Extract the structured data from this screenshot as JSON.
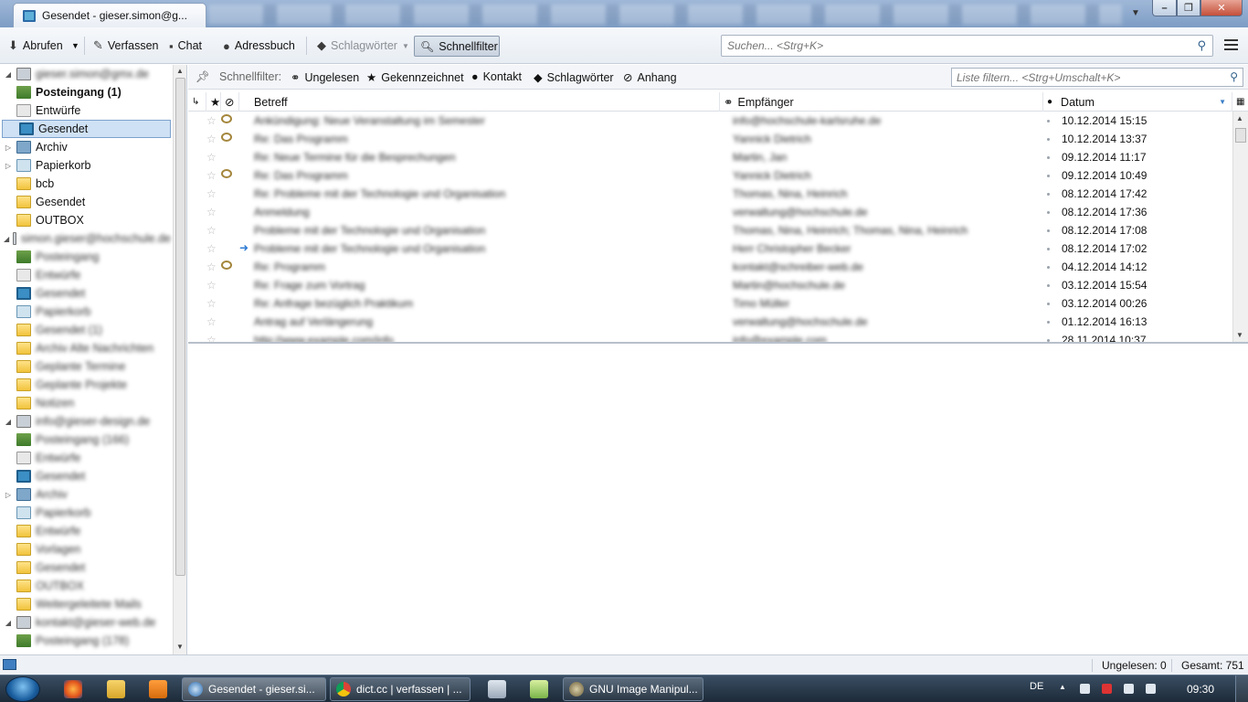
{
  "window": {
    "tab_title": "Gesendet - gieser.simon@g...",
    "close_glyph": "✕",
    "max_glyph": "❐",
    "min_glyph": "–"
  },
  "toolbar": {
    "abrufen": "Abrufen",
    "verfassen": "Verfassen",
    "chat": "Chat",
    "adressbuch": "Adressbuch",
    "schlagwoerter": "Schlagwörter",
    "schnellfilter": "Schnellfilter",
    "search_placeholder": "Suchen... <Strg+K>"
  },
  "folders": {
    "account1": "gieser.simon@gmx.de",
    "items": [
      {
        "label": "Posteingang (1)",
        "icon": "inbox-icon"
      },
      {
        "label": "Entwürfe",
        "icon": "drafts-icon"
      },
      {
        "label": "Gesendet",
        "icon": "sent-icon"
      },
      {
        "label": "Archiv",
        "icon": "archive-icon"
      },
      {
        "label": "Papierkorb",
        "icon": "trash-icon"
      },
      {
        "label": "bcb",
        "icon": "folder-icon"
      },
      {
        "label": "Gesendet",
        "icon": "folder-icon"
      },
      {
        "label": "OUTBOX",
        "icon": "folder-icon"
      }
    ],
    "account2": "simon.gieser@hochschule.de",
    "account2_items": [
      "Posteingang",
      "Entwürfe",
      "Gesendet",
      "Papierkorb",
      "Gesendet (1)",
      "Archiv Alte Nachrichten",
      "Geplante Termine",
      "Geplante Projekte",
      "Notizen"
    ],
    "account3": "info@gieser-design.de",
    "account3_items": [
      "Posteingang (166)",
      "Entwürfe",
      "Gesendet",
      "Archiv",
      "Papierkorb",
      "Entwürfe",
      "Vorlagen",
      "Gesendet",
      "OUTBOX",
      "Weitergeleitete Mails"
    ],
    "account4": "kontakt@gieser-web.de",
    "account4_items": [
      "Posteingang (178)"
    ]
  },
  "quickfilter": {
    "label": "Schnellfilter:",
    "ungelesen": "Ungelesen",
    "gekennzeichnet": "Gekennzeichnet",
    "kontakt": "Kontakt",
    "schlagwoerter": "Schlagwörter",
    "anhang": "Anhang",
    "search_placeholder": "Liste filtern... <Strg+Umschalt+K>"
  },
  "columns": {
    "betreff": "Betreff",
    "empfaenger": "Empfänger",
    "datum": "Datum"
  },
  "messages": [
    {
      "subject": "Ankündigung: Neue Veranstaltung im Semester",
      "recipient": "info@hochschule-karlsruhe.de",
      "date": "10.12.2014 15:15",
      "attachment": true,
      "replied": false
    },
    {
      "subject": "Re: Das Programm",
      "recipient": "Yannick Dietrich",
      "date": "10.12.2014 13:37",
      "attachment": true,
      "replied": false
    },
    {
      "subject": "Re: Neue Termine für die Besprechungen",
      "recipient": "Martin, Jan",
      "date": "09.12.2014 11:17",
      "attachment": false,
      "replied": false
    },
    {
      "subject": "Re: Das Programm",
      "recipient": "Yannick Dietrich",
      "date": "09.12.2014 10:49",
      "attachment": true,
      "replied": false
    },
    {
      "subject": "Re: Probleme mit der Technologie und Organisation",
      "recipient": "Thomas, Nina, Heinrich",
      "date": "08.12.2014 17:42",
      "attachment": false,
      "replied": false
    },
    {
      "subject": "Anmeldung",
      "recipient": "verwaltung@hochschule.de",
      "date": "08.12.2014 17:36",
      "attachment": false,
      "replied": false
    },
    {
      "subject": "Probleme mit der Technologie und Organisation",
      "recipient": "Thomas, Nina, Heinrich; Thomas, Nina, Heinrich",
      "date": "08.12.2014 17:08",
      "attachment": false,
      "replied": false
    },
    {
      "subject": "Probleme mit der Technologie und Organisation",
      "recipient": "Herr Christopher Becker",
      "date": "08.12.2014 17:02",
      "attachment": false,
      "replied": true
    },
    {
      "subject": "Re: Programm",
      "recipient": "kontakt@schreiber-web.de",
      "date": "04.12.2014 14:12",
      "attachment": true,
      "replied": false
    },
    {
      "subject": "Re: Frage zum Vortrag",
      "recipient": "Martin@hochschule.de",
      "date": "03.12.2014 15:54",
      "attachment": false,
      "replied": false
    },
    {
      "subject": "Re: Anfrage bezüglich Praktikum",
      "recipient": "Timo Müller",
      "date": "03.12.2014 00:26",
      "attachment": false,
      "replied": false
    },
    {
      "subject": "Antrag auf Verlängerung",
      "recipient": "verwaltung@hochschule.de",
      "date": "01.12.2014 16:13",
      "attachment": false,
      "replied": false
    },
    {
      "subject": "http://www.example.com/info",
      "recipient": "info@example.com",
      "date": "28.11.2014 10:37",
      "attachment": false,
      "replied": false
    }
  ],
  "status": {
    "unread": "Ungelesen: 0",
    "total": "Gesamt: 751"
  },
  "taskbar": {
    "tasks": [
      {
        "label": "Gesendet - gieser.si...",
        "active": true
      },
      {
        "label": "dict.cc | verfassen | ...",
        "active": false
      },
      {
        "label": "GNU Image Manipul...",
        "active": false
      }
    ],
    "lang": "DE",
    "clock": "09:30"
  }
}
